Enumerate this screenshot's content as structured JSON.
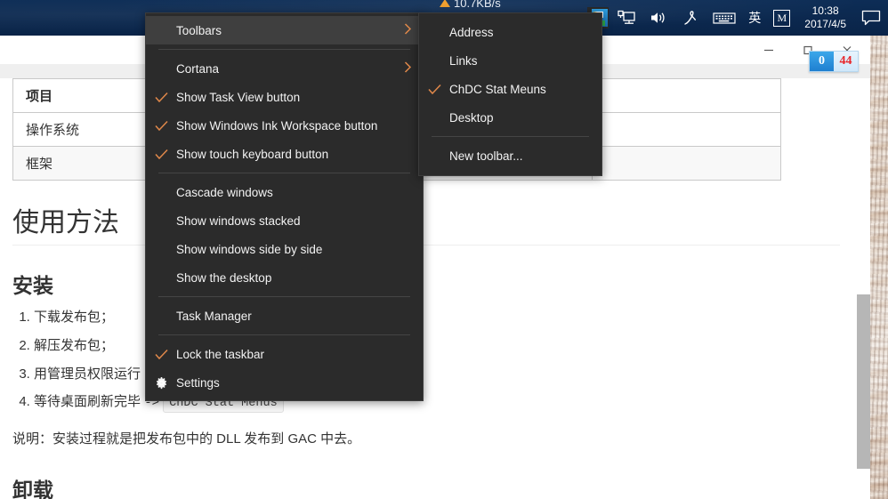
{
  "taskbar": {
    "network_speed": "10.7KB/s",
    "tray_icons": [
      {
        "name": "app-window-icon",
        "glyph": ""
      },
      {
        "name": "onedrive-cloud-icon",
        "glyph": ""
      },
      {
        "name": "network-icon",
        "glyph": ""
      },
      {
        "name": "volume-icon",
        "glyph": ""
      },
      {
        "name": "pen-ink-icon",
        "glyph": ""
      },
      {
        "name": "touch-keyboard-icon",
        "glyph": ""
      },
      {
        "name": "ime-language-icon",
        "glyph": "英"
      },
      {
        "name": "ime-mode-icon",
        "glyph": "M"
      }
    ],
    "clock_time": "10:38",
    "clock_date": "2017/4/5",
    "action_center_icon": "notification-icon"
  },
  "window": {
    "minimize_label": "—",
    "maximize_label": "□",
    "close_label": "✕"
  },
  "counter_widget": {
    "left_value": "0",
    "right_value": "44",
    "left_color": "#ffffff",
    "right_color": "#e8262a"
  },
  "context_menu": {
    "items": [
      {
        "label": "Toolbars",
        "checked": false,
        "submenu": true,
        "highlighted": true,
        "gear": false
      },
      {
        "separator": true
      },
      {
        "label": "Cortana",
        "checked": false,
        "submenu": true,
        "highlighted": false,
        "gear": false
      },
      {
        "label": "Show Task View button",
        "checked": true,
        "submenu": false,
        "highlighted": false,
        "gear": false
      },
      {
        "label": "Show Windows Ink Workspace button",
        "checked": true,
        "submenu": false,
        "highlighted": false,
        "gear": false
      },
      {
        "label": "Show touch keyboard button",
        "checked": true,
        "submenu": false,
        "highlighted": false,
        "gear": false
      },
      {
        "separator": true
      },
      {
        "label": "Cascade windows",
        "checked": false,
        "submenu": false,
        "highlighted": false,
        "gear": false
      },
      {
        "label": "Show windows stacked",
        "checked": false,
        "submenu": false,
        "highlighted": false,
        "gear": false
      },
      {
        "label": "Show windows side by side",
        "checked": false,
        "submenu": false,
        "highlighted": false,
        "gear": false
      },
      {
        "label": "Show the desktop",
        "checked": false,
        "submenu": false,
        "highlighted": false,
        "gear": false
      },
      {
        "separator": true
      },
      {
        "label": "Task Manager",
        "checked": false,
        "submenu": false,
        "highlighted": false,
        "gear": false
      },
      {
        "separator": true
      },
      {
        "label": "Lock the taskbar",
        "checked": true,
        "submenu": false,
        "highlighted": false,
        "gear": false
      },
      {
        "label": "Settings",
        "checked": false,
        "submenu": false,
        "highlighted": false,
        "gear": true
      }
    ]
  },
  "toolbars_submenu": {
    "items": [
      {
        "label": "Address",
        "checked": false
      },
      {
        "label": "Links",
        "checked": false
      },
      {
        "label": "ChDC Stat Meuns",
        "checked": true
      },
      {
        "label": "Desktop",
        "checked": false
      },
      {
        "separator": true
      },
      {
        "label": "New toolbar...",
        "checked": false
      }
    ]
  },
  "document": {
    "table": {
      "header": "项目",
      "rows": [
        "操作系统",
        "框架"
      ]
    },
    "heading_usage": "使用方法",
    "heading_install": "安装",
    "steps": [
      "下载发布包；",
      "解压发布包；",
      "用管理员权限运行",
      "等待桌面刷新完毕"
    ],
    "step4_arrow": "->",
    "step4_code": "ChDC Stat Menus",
    "note": "说明：安装过程就是把发布包中的 DLL 发布到 GAC 中去。",
    "heading_uninstall": "卸载"
  },
  "colors": {
    "taskbar_bg": "#0b2a50",
    "menu_bg": "#2b2b2b",
    "menu_highlight": "#3f3f3f",
    "menu_accent": "#e0884a",
    "table_border": "#c9c9c9",
    "stripe_bg": "#f8f8f8"
  }
}
